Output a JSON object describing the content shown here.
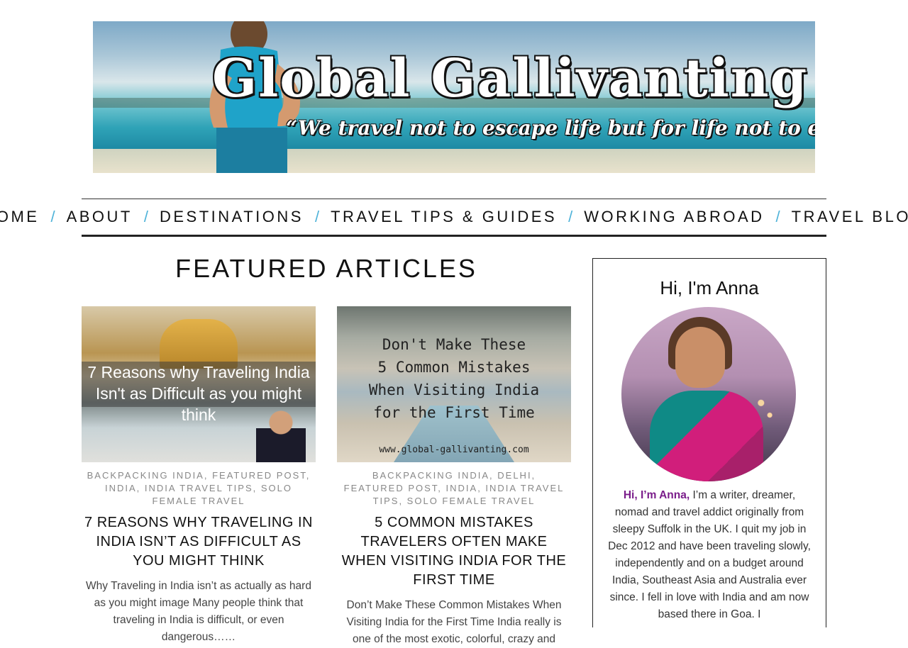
{
  "header": {
    "site_title": "Global Gallivanting",
    "tagline": "“We travel not to escape life but for life not to escape us.”"
  },
  "nav": {
    "items": [
      "HOME",
      "ABOUT",
      "DESTINATIONS",
      "TRAVEL TIPS & GUIDES",
      "WORKING ABROAD",
      "TRAVEL BLOG"
    ],
    "separator": "/"
  },
  "featured": {
    "heading": "FEATURED ARTICLES",
    "posts": [
      {
        "image_text": "7 Reasons why Traveling India Isn't as Difficult as you might think",
        "categories_text": "BACKPACKING INDIA, FEATURED POST, INDIA, INDIA TRAVEL TIPS, SOLO FEMALE TRAVEL",
        "title": "7 REASONS WHY TRAVELING IN INDIA ISN’T AS DIFFICULT AS YOU MIGHT THINK",
        "excerpt": "Why Traveling in India isn’t as actually as hard as you might image Many people think that traveling in India is difficult, or even dangerous……"
      },
      {
        "image_text": "Don't Make These\n5 Common Mistakes\nWhen Visiting India\nfor the First Time",
        "image_url_text": "www.global-gallivanting.com",
        "categories_text": "BACKPACKING INDIA, DELHI, FEATURED POST, INDIA, INDIA TRAVEL TIPS, SOLO FEMALE TRAVEL",
        "title": "5 COMMON MISTAKES TRAVELERS OFTEN MAKE WHEN VISITING INDIA FOR THE FIRST TIME",
        "excerpt": "Don’t Make These Common Mistakes When Visiting India for the First Time India really is one of the most exotic, colorful, crazy and"
      }
    ]
  },
  "sidebar": {
    "heading": "Hi, I'm Anna",
    "bio_lead": "Hi, I’m Anna,",
    "bio_rest": " I’m a writer, dreamer, nomad and travel addict originally from sleepy Suffolk in the UK. I quit my job in Dec 2012 and have been traveling slowly, independently and on a budget around India, Southeast Asia and Australia ever since. I fell in love with India and am now based there in Goa. I"
  },
  "colors": {
    "nav_separator": "#4fb3d9",
    "bio_highlight": "#7a1c8a"
  }
}
